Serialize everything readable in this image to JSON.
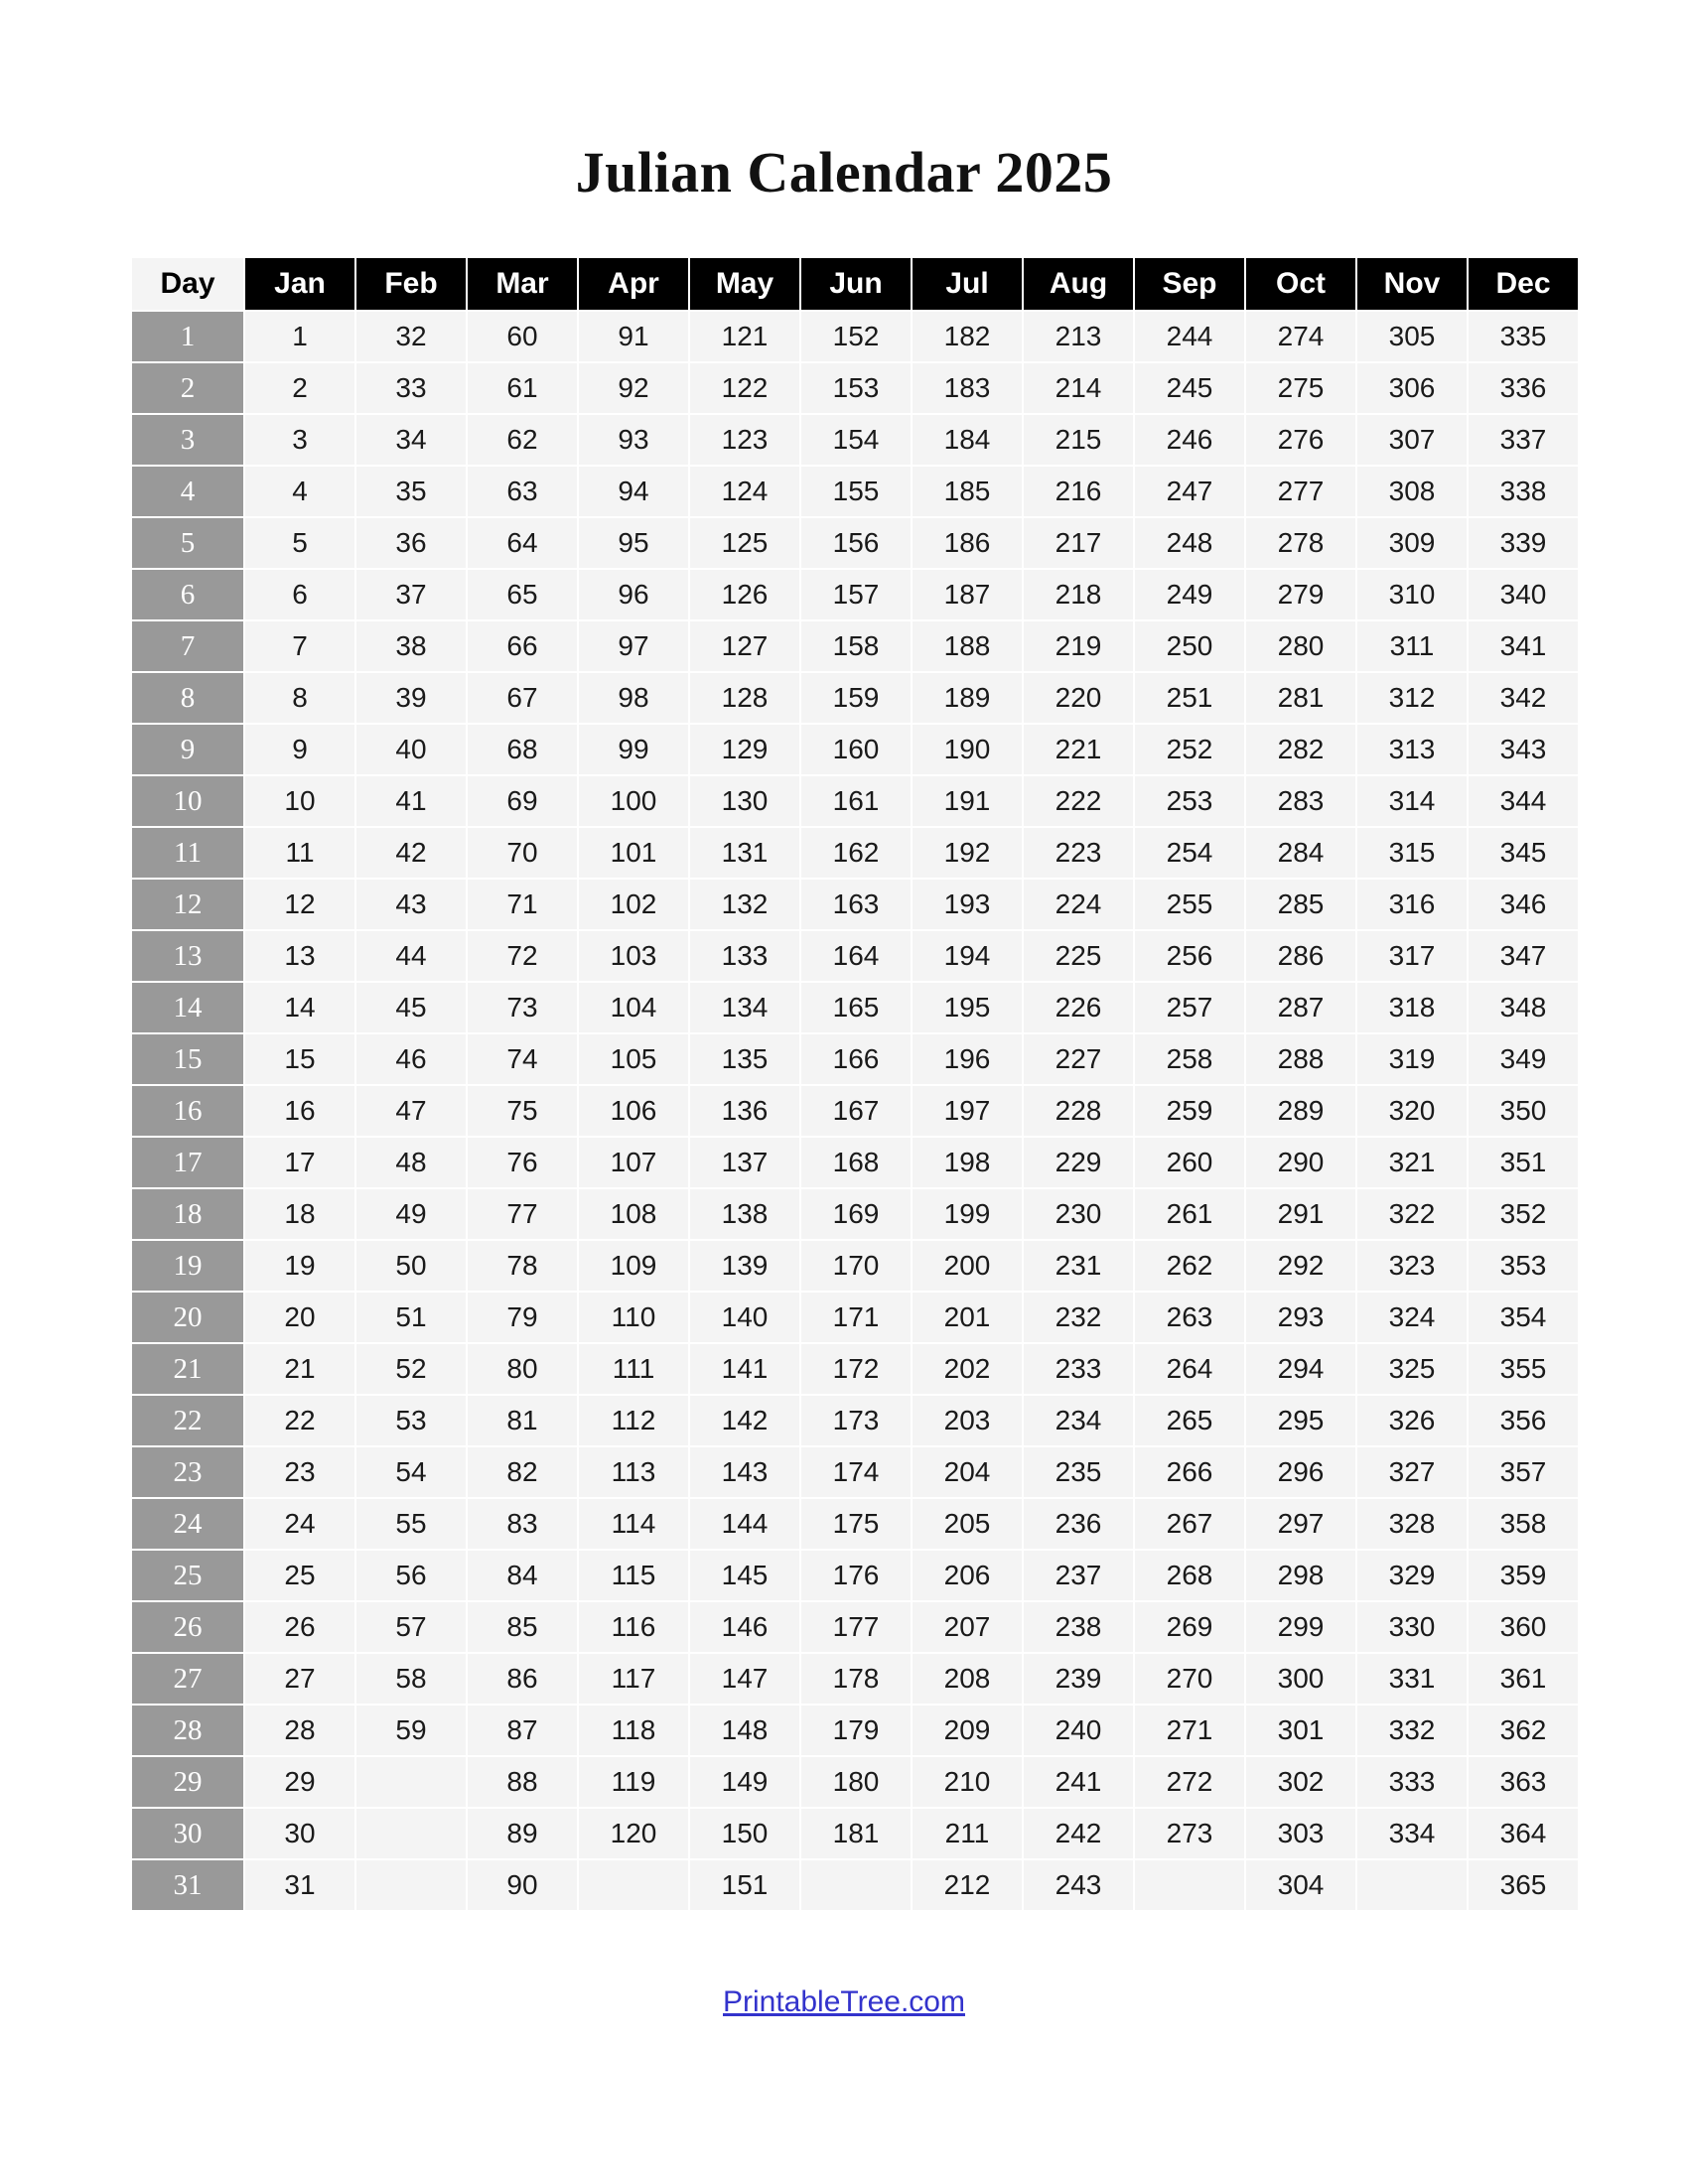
{
  "title": "Julian Calendar 2025",
  "table": {
    "day_header": "Day",
    "months": [
      "Jan",
      "Feb",
      "Mar",
      "Apr",
      "May",
      "Jun",
      "Jul",
      "Aug",
      "Sep",
      "Oct",
      "Nov",
      "Dec"
    ],
    "rows": [
      {
        "day": "1",
        "values": [
          "1",
          "32",
          "60",
          "91",
          "121",
          "152",
          "182",
          "213",
          "244",
          "274",
          "305",
          "335"
        ]
      },
      {
        "day": "2",
        "values": [
          "2",
          "33",
          "61",
          "92",
          "122",
          "153",
          "183",
          "214",
          "245",
          "275",
          "306",
          "336"
        ]
      },
      {
        "day": "3",
        "values": [
          "3",
          "34",
          "62",
          "93",
          "123",
          "154",
          "184",
          "215",
          "246",
          "276",
          "307",
          "337"
        ]
      },
      {
        "day": "4",
        "values": [
          "4",
          "35",
          "63",
          "94",
          "124",
          "155",
          "185",
          "216",
          "247",
          "277",
          "308",
          "338"
        ]
      },
      {
        "day": "5",
        "values": [
          "5",
          "36",
          "64",
          "95",
          "125",
          "156",
          "186",
          "217",
          "248",
          "278",
          "309",
          "339"
        ]
      },
      {
        "day": "6",
        "values": [
          "6",
          "37",
          "65",
          "96",
          "126",
          "157",
          "187",
          "218",
          "249",
          "279",
          "310",
          "340"
        ]
      },
      {
        "day": "7",
        "values": [
          "7",
          "38",
          "66",
          "97",
          "127",
          "158",
          "188",
          "219",
          "250",
          "280",
          "311",
          "341"
        ]
      },
      {
        "day": "8",
        "values": [
          "8",
          "39",
          "67",
          "98",
          "128",
          "159",
          "189",
          "220",
          "251",
          "281",
          "312",
          "342"
        ]
      },
      {
        "day": "9",
        "values": [
          "9",
          "40",
          "68",
          "99",
          "129",
          "160",
          "190",
          "221",
          "252",
          "282",
          "313",
          "343"
        ]
      },
      {
        "day": "10",
        "values": [
          "10",
          "41",
          "69",
          "100",
          "130",
          "161",
          "191",
          "222",
          "253",
          "283",
          "314",
          "344"
        ]
      },
      {
        "day": "11",
        "values": [
          "11",
          "42",
          "70",
          "101",
          "131",
          "162",
          "192",
          "223",
          "254",
          "284",
          "315",
          "345"
        ]
      },
      {
        "day": "12",
        "values": [
          "12",
          "43",
          "71",
          "102",
          "132",
          "163",
          "193",
          "224",
          "255",
          "285",
          "316",
          "346"
        ]
      },
      {
        "day": "13",
        "values": [
          "13",
          "44",
          "72",
          "103",
          "133",
          "164",
          "194",
          "225",
          "256",
          "286",
          "317",
          "347"
        ]
      },
      {
        "day": "14",
        "values": [
          "14",
          "45",
          "73",
          "104",
          "134",
          "165",
          "195",
          "226",
          "257",
          "287",
          "318",
          "348"
        ]
      },
      {
        "day": "15",
        "values": [
          "15",
          "46",
          "74",
          "105",
          "135",
          "166",
          "196",
          "227",
          "258",
          "288",
          "319",
          "349"
        ]
      },
      {
        "day": "16",
        "values": [
          "16",
          "47",
          "75",
          "106",
          "136",
          "167",
          "197",
          "228",
          "259",
          "289",
          "320",
          "350"
        ]
      },
      {
        "day": "17",
        "values": [
          "17",
          "48",
          "76",
          "107",
          "137",
          "168",
          "198",
          "229",
          "260",
          "290",
          "321",
          "351"
        ]
      },
      {
        "day": "18",
        "values": [
          "18",
          "49",
          "77",
          "108",
          "138",
          "169",
          "199",
          "230",
          "261",
          "291",
          "322",
          "352"
        ]
      },
      {
        "day": "19",
        "values": [
          "19",
          "50",
          "78",
          "109",
          "139",
          "170",
          "200",
          "231",
          "262",
          "292",
          "323",
          "353"
        ]
      },
      {
        "day": "20",
        "values": [
          "20",
          "51",
          "79",
          "110",
          "140",
          "171",
          "201",
          "232",
          "263",
          "293",
          "324",
          "354"
        ]
      },
      {
        "day": "21",
        "values": [
          "21",
          "52",
          "80",
          "111",
          "141",
          "172",
          "202",
          "233",
          "264",
          "294",
          "325",
          "355"
        ]
      },
      {
        "day": "22",
        "values": [
          "22",
          "53",
          "81",
          "112",
          "142",
          "173",
          "203",
          "234",
          "265",
          "295",
          "326",
          "356"
        ]
      },
      {
        "day": "23",
        "values": [
          "23",
          "54",
          "82",
          "113",
          "143",
          "174",
          "204",
          "235",
          "266",
          "296",
          "327",
          "357"
        ]
      },
      {
        "day": "24",
        "values": [
          "24",
          "55",
          "83",
          "114",
          "144",
          "175",
          "205",
          "236",
          "267",
          "297",
          "328",
          "358"
        ]
      },
      {
        "day": "25",
        "values": [
          "25",
          "56",
          "84",
          "115",
          "145",
          "176",
          "206",
          "237",
          "268",
          "298",
          "329",
          "359"
        ]
      },
      {
        "day": "26",
        "values": [
          "26",
          "57",
          "85",
          "116",
          "146",
          "177",
          "207",
          "238",
          "269",
          "299",
          "330",
          "360"
        ]
      },
      {
        "day": "27",
        "values": [
          "27",
          "58",
          "86",
          "117",
          "147",
          "178",
          "208",
          "239",
          "270",
          "300",
          "331",
          "361"
        ]
      },
      {
        "day": "28",
        "values": [
          "28",
          "59",
          "87",
          "118",
          "148",
          "179",
          "209",
          "240",
          "271",
          "301",
          "332",
          "362"
        ]
      },
      {
        "day": "29",
        "values": [
          "29",
          "",
          "88",
          "119",
          "149",
          "180",
          "210",
          "241",
          "272",
          "302",
          "333",
          "363"
        ]
      },
      {
        "day": "30",
        "values": [
          "30",
          "",
          "89",
          "120",
          "150",
          "181",
          "211",
          "242",
          "273",
          "303",
          "334",
          "364"
        ]
      },
      {
        "day": "31",
        "values": [
          "31",
          "",
          "90",
          "",
          "151",
          "",
          "212",
          "243",
          "",
          "304",
          "",
          "365"
        ]
      }
    ]
  },
  "footer": {
    "link_text": "PrintableTree.com"
  },
  "colors": {
    "header_bg": "#000000",
    "header_text": "#ffffff",
    "day_header_bg": "#f4f4f4",
    "day_col_bg": "#999999",
    "day_col_text": "#ffffff",
    "cell_bg": "#f4f4f4",
    "cell_text": "#1a1a1a",
    "link": "#3333cc",
    "page_bg": "#ffffff"
  }
}
